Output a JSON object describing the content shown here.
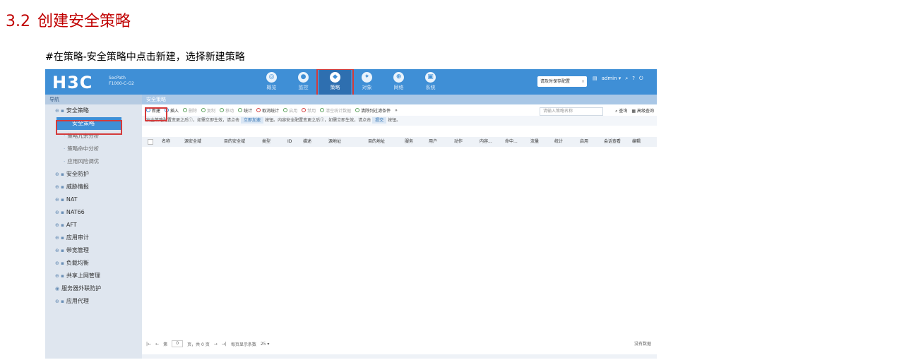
{
  "doc": {
    "heading_num": "3.2",
    "heading_text": "创建安全策略",
    "instruction": "#在策略-安全策略中点击新建，选择新建策略"
  },
  "app": {
    "logo": "H3C",
    "product_line1": "SecPath",
    "product_line2": "F1000-C-G2",
    "nav": [
      {
        "label": "概览",
        "icon": "dashboard-icon",
        "glyph": "◎"
      },
      {
        "label": "监控",
        "icon": "monitor-icon",
        "glyph": "●"
      },
      {
        "label": "策略",
        "icon": "policy-shield-icon",
        "glyph": "◆"
      },
      {
        "label": "对象",
        "icon": "object-share-icon",
        "glyph": "✦"
      },
      {
        "label": "网络",
        "icon": "network-globe-icon",
        "glyph": "⊕"
      },
      {
        "label": "系统",
        "icon": "system-monitor-icon",
        "glyph": "▣"
      }
    ],
    "active_nav": 2,
    "save_chip": "请及时保存配置",
    "user": "admin"
  },
  "sidebar": {
    "header": "导航",
    "items": [
      {
        "label": "安全策略",
        "type": "group"
      },
      {
        "label": "安全策略",
        "type": "active"
      },
      {
        "label": "策略冗余分析",
        "type": "sub"
      },
      {
        "label": "策略命中分析",
        "type": "sub"
      },
      {
        "label": "应用风险调优",
        "type": "sub"
      },
      {
        "label": "安全防护",
        "type": "group"
      },
      {
        "label": "威胁情报",
        "type": "group"
      },
      {
        "label": "NAT",
        "type": "group"
      },
      {
        "label": "NAT66",
        "type": "group"
      },
      {
        "label": "AFT",
        "type": "group"
      },
      {
        "label": "应用审计",
        "type": "group"
      },
      {
        "label": "带宽管理",
        "type": "group"
      },
      {
        "label": "负载均衡",
        "type": "group"
      },
      {
        "label": "共享上网管理",
        "type": "group"
      },
      {
        "label": "服务器外联防护",
        "type": "plain"
      },
      {
        "label": "应用代理",
        "type": "group"
      }
    ]
  },
  "main": {
    "breadcrumb": "安全策略",
    "toolbar": [
      {
        "label": "新建",
        "state": "on"
      },
      {
        "label": "插入",
        "state": "on"
      },
      {
        "label": "删除",
        "state": "dim"
      },
      {
        "label": "复制",
        "state": "dim"
      },
      {
        "label": "移动",
        "state": "dim"
      },
      {
        "label": "统计",
        "state": "on"
      },
      {
        "label": "取消统计",
        "state": "on"
      },
      {
        "label": "启用",
        "state": "dim"
      },
      {
        "label": "禁用",
        "state": "dim"
      },
      {
        "label": "清空统计数据",
        "state": "dim"
      },
      {
        "label": "清除列过滤条件",
        "state": "on"
      },
      {
        "label": "»",
        "state": "on"
      }
    ],
    "search_placeholder": "请输入策略名称",
    "search_btn": "查询",
    "adv_search_btn": "高级查询",
    "notice_part1": "安全策略配置变更之后",
    "notice_part2": "，如需立即生效，请点击",
    "notice_btn1": "立即加速",
    "notice_part3": "按钮。内容安全配置变更之后",
    "notice_part4": "，如需立即生效，请点击",
    "notice_btn2": "提交",
    "notice_part5": "按钮。",
    "columns": [
      "名称",
      "源安全域",
      "目的安全域",
      "类型",
      "ID",
      "描述",
      "源地址",
      "目的地址",
      "服务",
      "用户",
      "动作",
      "内容...",
      "命中...",
      "流量",
      "统计",
      "启用",
      "会话查看",
      "编辑"
    ],
    "pager": {
      "page_label": "第",
      "page_value": "0",
      "of_pages": "页，共 0 页",
      "per_page_label": "每页显示条数",
      "per_page": "25"
    },
    "no_data": "没有数据"
  }
}
